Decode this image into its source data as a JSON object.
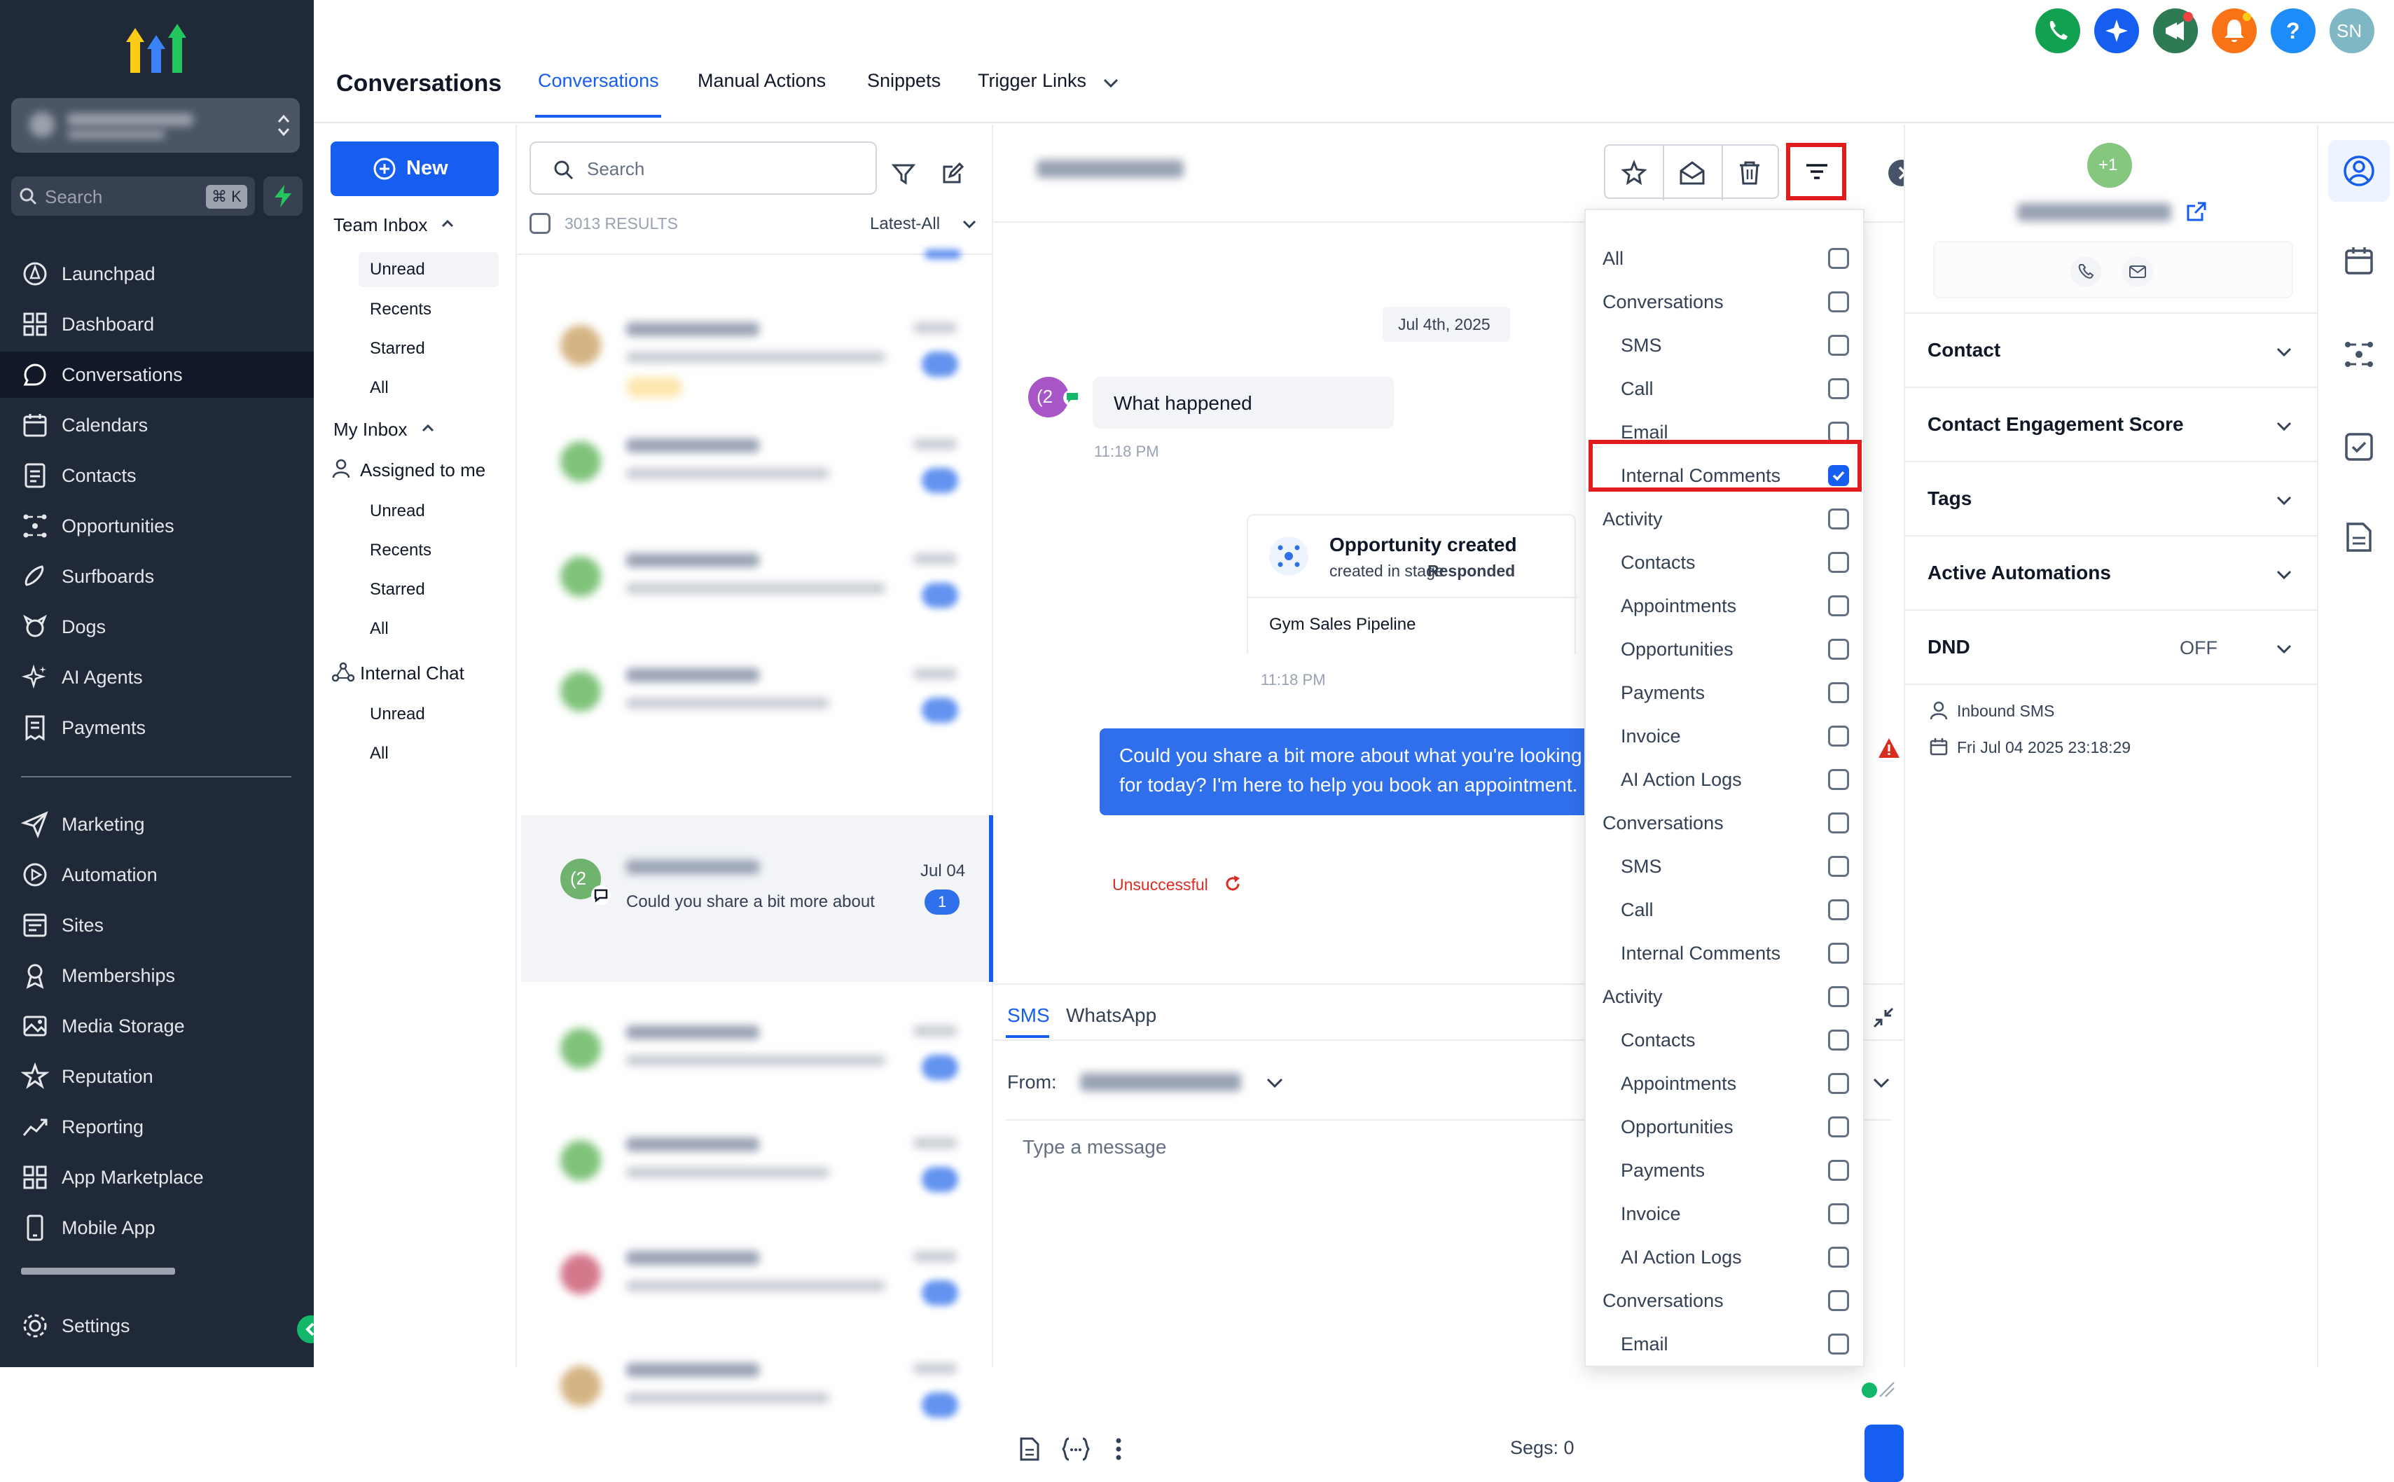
{
  "sidebar": {
    "search_placeholder": "Search",
    "search_shortcut": "⌘ K",
    "items": [
      {
        "label": "Launchpad",
        "icon": "launchpad-icon"
      },
      {
        "label": "Dashboard",
        "icon": "dashboard-icon"
      },
      {
        "label": "Conversations",
        "icon": "chat-icon"
      },
      {
        "label": "Calendars",
        "icon": "calendar-icon"
      },
      {
        "label": "Contacts",
        "icon": "contacts-icon"
      },
      {
        "label": "Opportunities",
        "icon": "opportunities-icon"
      },
      {
        "label": "Surfboards",
        "icon": "surfboard-icon"
      },
      {
        "label": "Dogs",
        "icon": "dog-icon"
      },
      {
        "label": "AI Agents",
        "icon": "sparkle-icon"
      },
      {
        "label": "Payments",
        "icon": "receipt-icon"
      }
    ],
    "items2": [
      {
        "label": "Marketing",
        "icon": "send-icon"
      },
      {
        "label": "Automation",
        "icon": "automation-icon"
      },
      {
        "label": "Sites",
        "icon": "sites-icon"
      },
      {
        "label": "Memberships",
        "icon": "memberships-icon"
      },
      {
        "label": "Media Storage",
        "icon": "media-icon"
      },
      {
        "label": "Reputation",
        "icon": "star-icon"
      },
      {
        "label": "Reporting",
        "icon": "reporting-icon"
      },
      {
        "label": "App Marketplace",
        "icon": "apps-icon"
      },
      {
        "label": "Mobile App",
        "icon": "mobile-icon"
      }
    ],
    "settings_label": "Settings"
  },
  "header": {
    "title": "Conversations",
    "tabs": [
      "Conversations",
      "Manual Actions",
      "Snippets",
      "Trigger Links"
    ],
    "avatar_initials": "SN",
    "help_label": "?"
  },
  "inbox": {
    "new_label": "New",
    "team_inbox": "Team Inbox",
    "team_items": [
      "Unread",
      "Recents",
      "Starred",
      "All"
    ],
    "my_inbox": "My Inbox",
    "assigned_to_me": "Assigned to me",
    "my_items": [
      "Unread",
      "Recents",
      "Starred",
      "All"
    ],
    "internal_chat": "Internal Chat",
    "chat_items": [
      "Unread",
      "All"
    ]
  },
  "list": {
    "search_placeholder": "Search",
    "results": "3013 RESULTS",
    "sort": "Latest-All",
    "selected": {
      "avatar": "(2",
      "preview": "Could you share a bit more about",
      "date": "Jul 04",
      "badge": "1"
    }
  },
  "conversation": {
    "date_divider": "Jul 4th, 2025",
    "avatar": "(2",
    "msg_in": "What happened",
    "msg_in_time": "11:18 PM",
    "opp_title": "Opportunity created",
    "opp_sub_prefix": "created in stage",
    "opp_stage": "Responded",
    "opp_pipeline": "Gym Sales Pipeline",
    "opp_time": "11:18 PM",
    "msg_out": "Could you share a bit more about what you're looking for today? I'm here to help you book an appointment.",
    "status": "Unsuccessful",
    "compose_tabs": [
      "SMS",
      "WhatsApp"
    ],
    "from_label": "From:",
    "message_placeholder": "Type a message",
    "segs": "Segs: 0"
  },
  "dropdown": {
    "items": [
      {
        "label": "All",
        "indent": false,
        "checked": false
      },
      {
        "label": "Conversations",
        "indent": false,
        "checked": false
      },
      {
        "label": "SMS",
        "indent": true,
        "checked": false
      },
      {
        "label": "Call",
        "indent": true,
        "checked": false
      },
      {
        "label": "Email",
        "indent": true,
        "checked": false
      },
      {
        "label": "Internal Comments",
        "indent": true,
        "checked": true
      },
      {
        "label": "Activity",
        "indent": false,
        "checked": false
      },
      {
        "label": "Contacts",
        "indent": true,
        "checked": false
      },
      {
        "label": "Appointments",
        "indent": true,
        "checked": false
      },
      {
        "label": "Opportunities",
        "indent": true,
        "checked": false
      },
      {
        "label": "Payments",
        "indent": true,
        "checked": false
      },
      {
        "label": "Invoice",
        "indent": true,
        "checked": false
      },
      {
        "label": "AI Action Logs",
        "indent": true,
        "checked": false
      },
      {
        "label": "Conversations",
        "indent": false,
        "checked": false
      },
      {
        "label": "SMS",
        "indent": true,
        "checked": false
      },
      {
        "label": "Call",
        "indent": true,
        "checked": false
      },
      {
        "label": "Internal Comments",
        "indent": true,
        "checked": false
      },
      {
        "label": "Activity",
        "indent": false,
        "checked": false
      },
      {
        "label": "Contacts",
        "indent": true,
        "checked": false
      },
      {
        "label": "Appointments",
        "indent": true,
        "checked": false
      },
      {
        "label": "Opportunities",
        "indent": true,
        "checked": false
      },
      {
        "label": "Payments",
        "indent": true,
        "checked": false
      },
      {
        "label": "Invoice",
        "indent": true,
        "checked": false
      },
      {
        "label": "AI Action Logs",
        "indent": true,
        "checked": false
      },
      {
        "label": "Conversations",
        "indent": false,
        "checked": false
      },
      {
        "label": "Email",
        "indent": true,
        "checked": false
      }
    ]
  },
  "contact_panel": {
    "avatar": "+1",
    "sections": [
      "Contact",
      "Contact Engagement Score",
      "Tags",
      "Active Automations",
      "DND"
    ],
    "dnd_value": "OFF",
    "inbound": "Inbound SMS",
    "inbound_time": "Fri Jul 04 2025 23:18:29"
  },
  "colors": {
    "sidebar_bg": "#1f2937",
    "accent": "#155eef",
    "highlight_red": "#e11d1d",
    "error": "#d92d20"
  }
}
